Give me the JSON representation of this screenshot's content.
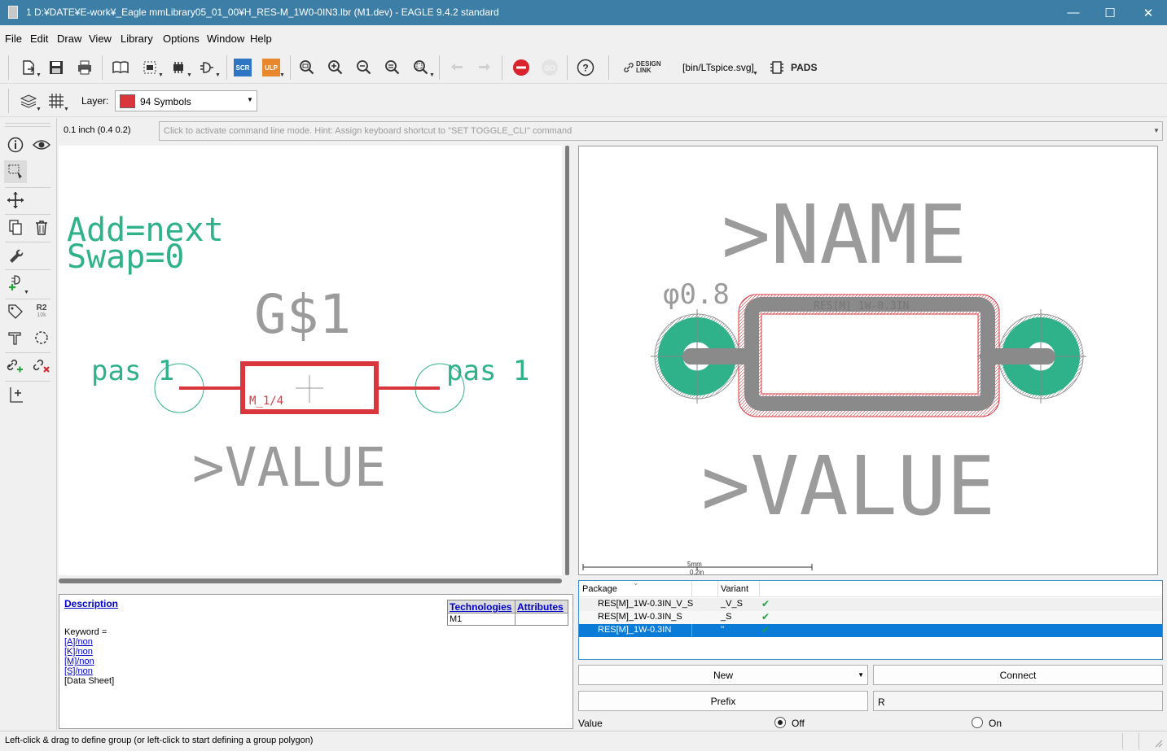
{
  "window": {
    "title": "1 D:¥DATE¥E-work¥_Eagle mmLibrary05_01_00¥H_RES-M_1W0-0IN3.lbr (M1.dev) - EAGLE 9.4.2 standard",
    "minimize": "—",
    "maximize": "☐",
    "close": "✕"
  },
  "menu": [
    "File",
    "Edit",
    "Draw",
    "View",
    "Library",
    "Options",
    "Window",
    "Help"
  ],
  "toolbar": {
    "scr_label": "SCR",
    "ulp_label": "ULP",
    "design_link_label": "DESIGN LINK",
    "ltspice_label": "[bin/LTspice.svg]",
    "pads_label": "PADS",
    "icons": [
      "new-file-icon",
      "save-icon",
      "print-icon",
      "open-library-icon",
      "device-icon",
      "package-icon",
      "symbol-icon",
      "script-icon",
      "ulp-icon",
      "zoom-fit-icon",
      "zoom-in-icon",
      "zoom-out-icon",
      "zoom-redraw-icon",
      "zoom-select-icon",
      "undo-icon",
      "redo-icon",
      "stop-icon",
      "go-icon",
      "help-icon"
    ]
  },
  "layerbar": {
    "layer_label": "Layer:",
    "layer_value": "94 Symbols",
    "layer_color": "#d9363e"
  },
  "command": {
    "coord": "0.1 inch (0.4 0.2)",
    "placeholder": "Click to activate command line mode. Hint: Assign keyboard shortcut to \"SET TOGGLE_CLI\" command"
  },
  "schematic": {
    "add_text": "Add=next",
    "swap_text": "Swap=0",
    "gate_name": "G$1",
    "pin_left": "pas 1",
    "pin_right": "pas 1",
    "symbol_label": "M_1/4",
    "value_text": ">VALUE",
    "symbol_color": "#d9363e",
    "text_color": "#2fb28a",
    "gray": "#9b9b9b"
  },
  "package": {
    "name_text": ">NAME",
    "value_text": ">VALUE",
    "phi_label": "φ0.8",
    "silk_label": "RES[M]_1W-0.3IN",
    "scale_mm": "5mm",
    "scale_in": "0.2in",
    "pad_color": "#2fb28a"
  },
  "description": {
    "heading": "Description",
    "keyword": "Keyword =",
    "links": [
      "[A]/non",
      "[K]/non",
      "[M]/non",
      "[S]/non"
    ],
    "datasheet": "[Data Sheet]",
    "tech_header": "Technologies",
    "attr_header": "Attributes",
    "tech_value": "M1"
  },
  "package_table": {
    "col_package": "Package",
    "col_variant": "Variant",
    "rows": [
      {
        "package": "RES[M]_1W-0.3IN_V_S",
        "variant": "_V_S",
        "check": "✔"
      },
      {
        "package": "RES[M]_1W-0.3IN_S",
        "variant": "_S",
        "check": "✔"
      },
      {
        "package": "RES[M]_1W-0.3IN",
        "variant": "''",
        "check": "✔"
      }
    ]
  },
  "controls": {
    "new_label": "New",
    "connect_label": "Connect",
    "prefix_label": "Prefix",
    "prefix_value": "R",
    "value_label": "Value",
    "off_label": "Off",
    "on_label": "On"
  },
  "lefttools": {
    "r2_label": "R2",
    "r2_sub": "10k"
  },
  "status": {
    "text": "Left-click & drag to define group (or left-click to start defining a group polygon)"
  }
}
